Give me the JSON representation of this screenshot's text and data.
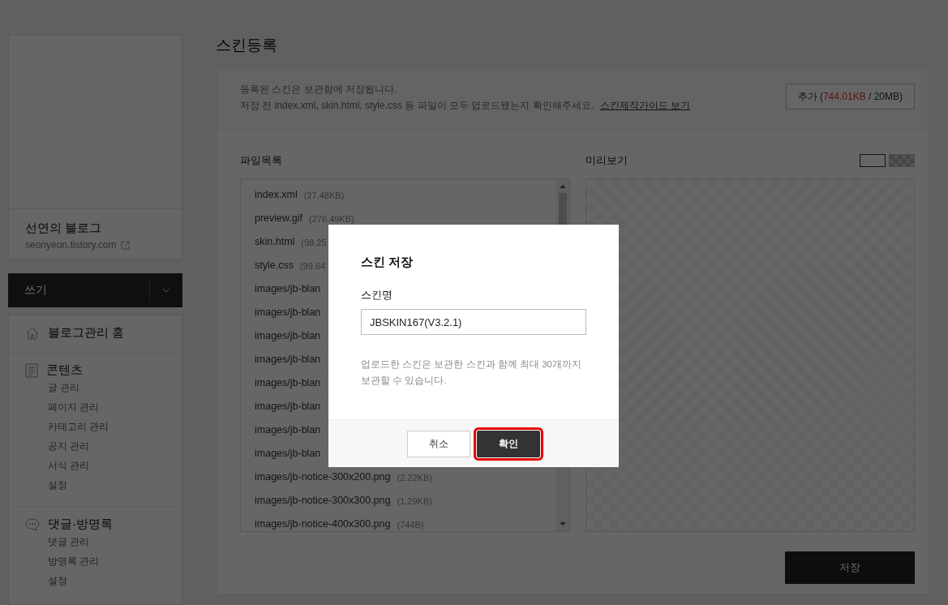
{
  "sidebar": {
    "blog_name": "선연의 블로그",
    "blog_url": "seonyeon.tistory.com",
    "write_button": "쓰기",
    "sections": [
      {
        "title": "블로그관리 홈"
      },
      {
        "title": "콘텐츠",
        "children": [
          "글 관리",
          "페이지 관리",
          "카테고리 관리",
          "공지 관리",
          "서식 관리",
          "설정"
        ]
      },
      {
        "title": "댓글·방명록",
        "children": [
          "댓글 관리",
          "방명록 관리",
          "설정"
        ]
      }
    ]
  },
  "page_title": "스킨등록",
  "notice": {
    "line_1": "등록된 스킨은 보관함에 저장됩니다.",
    "line_2": "저장 전 index.xml, skin.html, style.css 등 파일이 모두 업로드됐는지 확인해주세요.",
    "guide_link": "스킨제작가이드 보기"
  },
  "add_button": {
    "label": "추가",
    "open_paren": "(",
    "used": "744.01KB",
    "limit": "/ 20MB",
    "close_paren": ")"
  },
  "file_list": {
    "label": "파일목록",
    "files": [
      {
        "name": "index.xml",
        "size": "(27.48KB)"
      },
      {
        "name": "preview.gif",
        "size": "(276.49KB)"
      },
      {
        "name": "skin.html",
        "size": "(98.25"
      },
      {
        "name": "style.css",
        "size": "(99.64"
      },
      {
        "name": "images/jb-blan"
      },
      {
        "name": "images/jb-blan"
      },
      {
        "name": "images/jb-blan"
      },
      {
        "name": "images/jb-blan"
      },
      {
        "name": "images/jb-blan"
      },
      {
        "name": "images/jb-blan"
      },
      {
        "name": "images/jb-blan"
      },
      {
        "name": "images/jb-blan"
      },
      {
        "name": "images/jb-notice-300x200.png",
        "size": "(2.22KB)"
      },
      {
        "name": "images/jb-notice-300x300.png",
        "size": "(1.29KB)"
      },
      {
        "name": "images/jb-notice-400x300.png",
        "size": "(744B)"
      }
    ]
  },
  "preview": {
    "label": "미리보기",
    "modes": [
      {
        "selected": true
      },
      {
        "selected": false
      }
    ]
  },
  "save_button": "저장",
  "dialog": {
    "title": "스킨 저장",
    "field_label": "스킨명",
    "field_value": "JBSKIN167(V3.2.1)",
    "note_1": "업로드한 스킨은 보관한 스킨과 함께 최대 30개까지",
    "note_2": "보관할 수 있습니다.",
    "cancel": "취소",
    "confirm": "확인",
    "confirm_highlighted": true
  }
}
